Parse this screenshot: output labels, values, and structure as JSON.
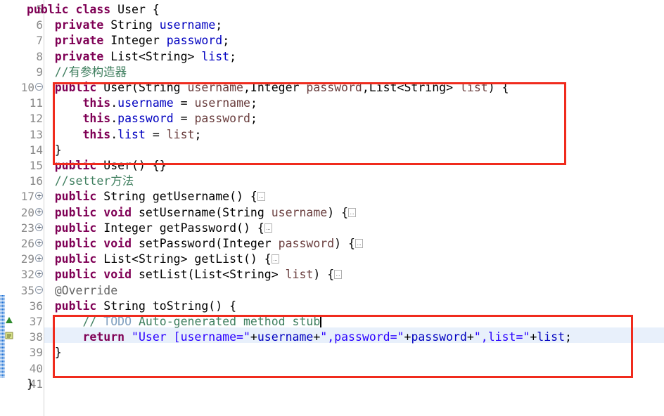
{
  "editor": {
    "language": "java",
    "file_class": "User",
    "current_line": 37,
    "colors": {
      "keyword": "#7f0055",
      "string": "#2a00ff",
      "comment": "#3f7f5f",
      "field": "#0000c0",
      "parameter": "#6a3e3e",
      "annotation": "#646464",
      "task_tag": "#7f9fbf",
      "line_number": "#8a8a8a",
      "current_line_background": "#e8f0fb",
      "highlight_rectangle": "#f02b1d",
      "change_bar": "#1a6fd4",
      "background": "#ffffff"
    }
  },
  "gutter": {
    "line_numbers": [
      {
        "num": "5",
        "marker": "none"
      },
      {
        "num": "6",
        "marker": "none"
      },
      {
        "num": "7",
        "marker": "none"
      },
      {
        "num": "8",
        "marker": "none"
      },
      {
        "num": "9",
        "marker": "none"
      },
      {
        "num": "10",
        "marker": "collapse"
      },
      {
        "num": "11",
        "marker": "none"
      },
      {
        "num": "12",
        "marker": "none"
      },
      {
        "num": "13",
        "marker": "none"
      },
      {
        "num": "14",
        "marker": "none"
      },
      {
        "num": "15",
        "marker": "none"
      },
      {
        "num": "16",
        "marker": "none"
      },
      {
        "num": "17",
        "marker": "expand"
      },
      {
        "num": "20",
        "marker": "expand"
      },
      {
        "num": "23",
        "marker": "expand"
      },
      {
        "num": "26",
        "marker": "expand"
      },
      {
        "num": "29",
        "marker": "expand"
      },
      {
        "num": "32",
        "marker": "expand"
      },
      {
        "num": "35",
        "marker": "collapse"
      },
      {
        "num": "36",
        "marker": "none"
      },
      {
        "num": "37",
        "marker": "none"
      },
      {
        "num": "38",
        "marker": "none"
      },
      {
        "num": "39",
        "marker": "none"
      },
      {
        "num": "40",
        "marker": "none"
      },
      {
        "num": "41",
        "marker": "none"
      }
    ]
  },
  "code": {
    "lines": [
      {
        "n": "5",
        "text": "public class User {"
      },
      {
        "n": "6",
        "text": "    private String username;"
      },
      {
        "n": "7",
        "text": "    private Integer password;"
      },
      {
        "n": "8",
        "text": "    private List<String> list;"
      },
      {
        "n": "9",
        "text": "    //有参构造器"
      },
      {
        "n": "10",
        "text": "    public User(String username,Integer password,List<String> list) {"
      },
      {
        "n": "11",
        "text": "        this.username = username;"
      },
      {
        "n": "12",
        "text": "        this.password = password;"
      },
      {
        "n": "13",
        "text": "        this.list = list;"
      },
      {
        "n": "14",
        "text": "    }"
      },
      {
        "n": "15",
        "text": "    public User() {}"
      },
      {
        "n": "16",
        "text": "    //setter方法"
      },
      {
        "n": "17",
        "text": "    public String getUsername() {"
      },
      {
        "n": "20",
        "text": "    public void setUsername(String username) {"
      },
      {
        "n": "23",
        "text": "    public Integer getPassword() {"
      },
      {
        "n": "26",
        "text": "    public void setPassword(Integer password) {"
      },
      {
        "n": "29",
        "text": "    public List<String> getList() {"
      },
      {
        "n": "32",
        "text": "    public void setList(List<String> list) {"
      },
      {
        "n": "35",
        "text": "    @Override"
      },
      {
        "n": "36",
        "text": "    public String toString() {"
      },
      {
        "n": "37",
        "text": "        // TODO Auto-generated method stub"
      },
      {
        "n": "38",
        "text": "        return \"User [username=\"+username+\",password=\"+password+\",list=\"+list;"
      },
      {
        "n": "39",
        "text": "    }"
      },
      {
        "n": "40",
        "text": ""
      },
      {
        "n": "41",
        "text": "}"
      }
    ]
  },
  "annotations": {
    "rectangles": [
      {
        "label": "constructor-highlight",
        "covers_lines": "10-14"
      },
      {
        "label": "tostring-highlight",
        "covers_lines": "36-40"
      }
    ]
  }
}
